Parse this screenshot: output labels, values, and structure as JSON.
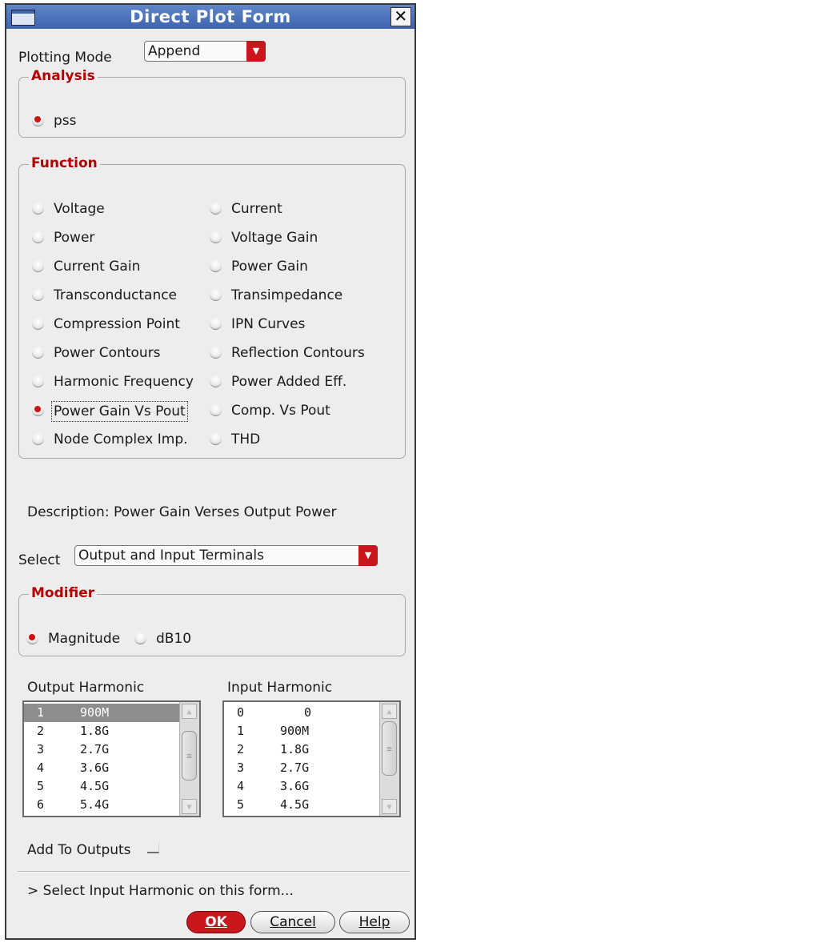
{
  "window": {
    "title": "Direct Plot Form",
    "close_glyph": "✕"
  },
  "plotting_mode": {
    "label": "Plotting Mode",
    "value": "Append"
  },
  "analysis": {
    "title": "Analysis",
    "options": [
      {
        "label": "pss",
        "selected": true
      }
    ]
  },
  "function": {
    "title": "Function",
    "left": [
      {
        "label": "Voltage",
        "selected": false
      },
      {
        "label": "Power",
        "selected": false
      },
      {
        "label": "Current Gain",
        "selected": false
      },
      {
        "label": "Transconductance",
        "selected": false
      },
      {
        "label": "Compression Point",
        "selected": false
      },
      {
        "label": "Power Contours",
        "selected": false
      },
      {
        "label": "Harmonic Frequency",
        "selected": false
      },
      {
        "label": "Power Gain Vs Pout",
        "selected": true
      },
      {
        "label": "Node Complex Imp.",
        "selected": false
      }
    ],
    "right": [
      {
        "label": "Current",
        "selected": false
      },
      {
        "label": "Voltage Gain",
        "selected": false
      },
      {
        "label": "Power Gain",
        "selected": false
      },
      {
        "label": "Transimpedance",
        "selected": false
      },
      {
        "label": "IPN Curves",
        "selected": false
      },
      {
        "label": "Reflection Contours",
        "selected": false
      },
      {
        "label": "Power Added Eff.",
        "selected": false
      },
      {
        "label": "Comp. Vs Pout",
        "selected": false
      },
      {
        "label": "THD",
        "selected": false
      }
    ]
  },
  "description": "Description: Power Gain Verses Output Power",
  "select": {
    "label": "Select",
    "value": "Output and Input Terminals"
  },
  "modifier": {
    "title": "Modifier",
    "options": [
      {
        "label": "Magnitude",
        "selected": true
      },
      {
        "label": "dB10",
        "selected": false
      }
    ]
  },
  "output_harmonic": {
    "label": "Output Harmonic",
    "rows": [
      {
        "index": "1",
        "freq": "900M",
        "selected": true
      },
      {
        "index": "2",
        "freq": "1.8G",
        "selected": false
      },
      {
        "index": "3",
        "freq": "2.7G",
        "selected": false
      },
      {
        "index": "4",
        "freq": "3.6G",
        "selected": false
      },
      {
        "index": "5",
        "freq": "4.5G",
        "selected": false
      },
      {
        "index": "6",
        "freq": "5.4G",
        "selected": false
      }
    ]
  },
  "input_harmonic": {
    "label": "Input Harmonic",
    "rows": [
      {
        "index": "0",
        "freq": "0",
        "selected": false
      },
      {
        "index": "1",
        "freq": "900M",
        "selected": false
      },
      {
        "index": "2",
        "freq": "1.8G",
        "selected": false
      },
      {
        "index": "3",
        "freq": "2.7G",
        "selected": false
      },
      {
        "index": "4",
        "freq": "3.6G",
        "selected": false
      },
      {
        "index": "5",
        "freq": "4.5G",
        "selected": false
      }
    ]
  },
  "add_to_outputs": {
    "label": "Add To Outputs",
    "checked": false
  },
  "status": "> Select Input Harmonic on this form...",
  "buttons": {
    "ok": "OK",
    "cancel": "Cancel",
    "help": "Help"
  },
  "icons": {
    "dropdown": "chevron-down-icon",
    "scroll_up": "arrow-up-icon",
    "scroll_down": "arrow-down-icon"
  }
}
